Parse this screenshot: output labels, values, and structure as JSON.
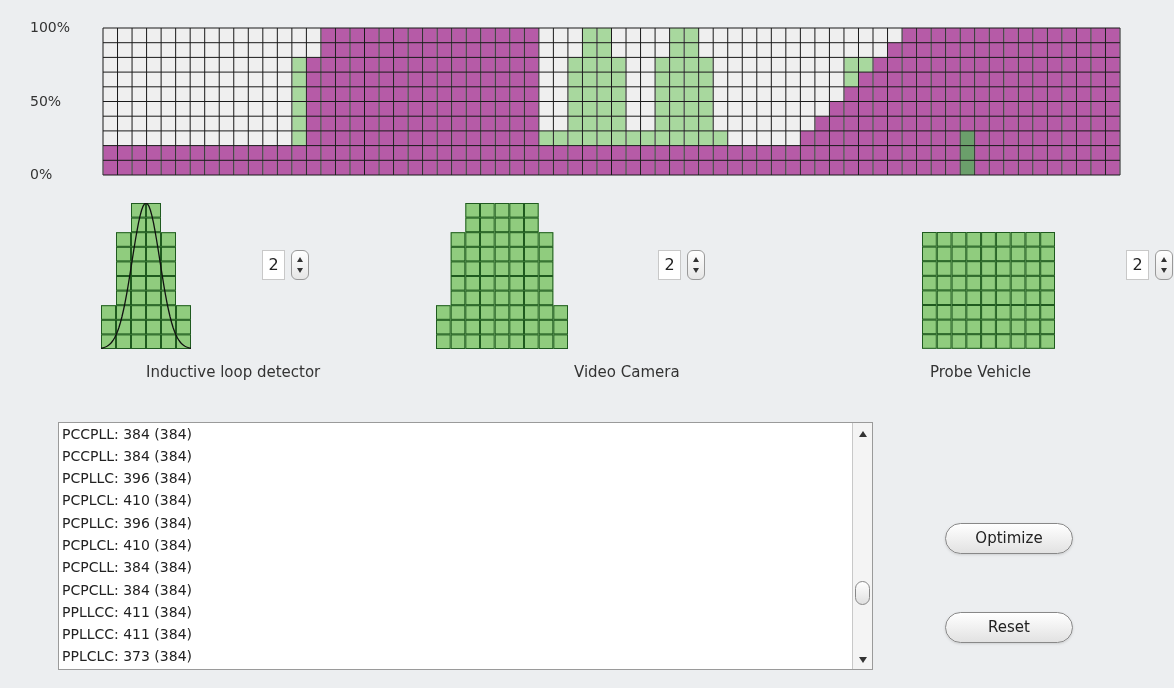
{
  "chart": {
    "chart_data": {
      "type": "bar",
      "stacked": true,
      "grid": true,
      "ylim": [
        0,
        100
      ],
      "yticks": [
        {
          "value": 0,
          "label": "0%"
        },
        {
          "value": 50,
          "label": "50%"
        },
        {
          "value": 100,
          "label": "100%"
        }
      ],
      "series": [
        {
          "color": "#6b9f6b",
          "values": [
            0,
            0,
            0,
            0,
            0,
            0,
            0,
            0,
            0,
            0,
            0,
            0,
            0,
            0,
            0,
            0,
            0,
            0,
            0,
            0,
            0,
            0,
            0,
            0,
            0,
            0,
            0,
            0,
            0,
            0,
            0,
            0,
            0,
            0,
            0,
            0,
            0,
            0,
            0,
            0,
            0,
            0,
            0,
            0,
            0,
            0,
            0,
            0,
            0,
            0,
            0,
            0,
            0,
            0,
            0,
            0,
            0,
            0,
            0,
            30,
            0,
            0,
            0,
            0,
            0,
            0,
            0,
            0,
            0,
            0
          ]
        },
        {
          "color": "#b65ba7",
          "values": [
            20,
            20,
            20,
            20,
            20,
            20,
            20,
            20,
            20,
            20,
            20,
            20,
            20,
            20,
            80,
            100,
            100,
            100,
            100,
            100,
            100,
            100,
            100,
            100,
            100,
            100,
            100,
            100,
            100,
            100,
            20,
            20,
            20,
            20,
            20,
            20,
            20,
            20,
            20,
            20,
            20,
            20,
            20,
            20,
            20,
            20,
            20,
            20,
            30,
            40,
            50,
            60,
            70,
            80,
            90,
            100,
            100,
            100,
            100,
            70,
            100,
            100,
            100,
            100,
            100,
            100,
            100,
            100,
            100,
            100
          ]
        },
        {
          "color": "#a8d89e",
          "values": [
            0,
            0,
            0,
            0,
            0,
            0,
            0,
            0,
            0,
            0,
            0,
            0,
            0,
            60,
            0,
            0,
            0,
            0,
            0,
            0,
            0,
            0,
            0,
            0,
            0,
            0,
            0,
            0,
            0,
            0,
            10,
            10,
            60,
            80,
            80,
            60,
            10,
            10,
            60,
            80,
            80,
            60,
            10,
            0,
            0,
            0,
            0,
            0,
            0,
            0,
            0,
            20,
            10,
            0,
            0,
            0,
            0,
            0,
            0,
            0,
            0,
            0,
            0,
            0,
            0,
            0,
            0,
            0,
            0,
            0
          ]
        }
      ]
    }
  },
  "sensors": [
    {
      "label": "Inductive loop detector",
      "count": "2"
    },
    {
      "label": "Video Camera",
      "count": "2"
    },
    {
      "label": "Probe Vehicle",
      "count": "2"
    }
  ],
  "results": {
    "items": [
      "PCCPLL: 384 (384)",
      "PCCPLL: 384 (384)",
      "PCPLLC: 396 (384)",
      "PCPLCL: 410 (384)",
      "PCPLLC: 396 (384)",
      "PCPLCL: 410 (384)",
      "PCPCLL: 384 (384)",
      "PCPCLL: 384 (384)",
      "PPLLCC: 411 (384)",
      "PPLLCC: 411 (384)",
      "PPLCLC: 373 (384)"
    ]
  },
  "buttons": [
    "Optimize",
    "Reset"
  ]
}
